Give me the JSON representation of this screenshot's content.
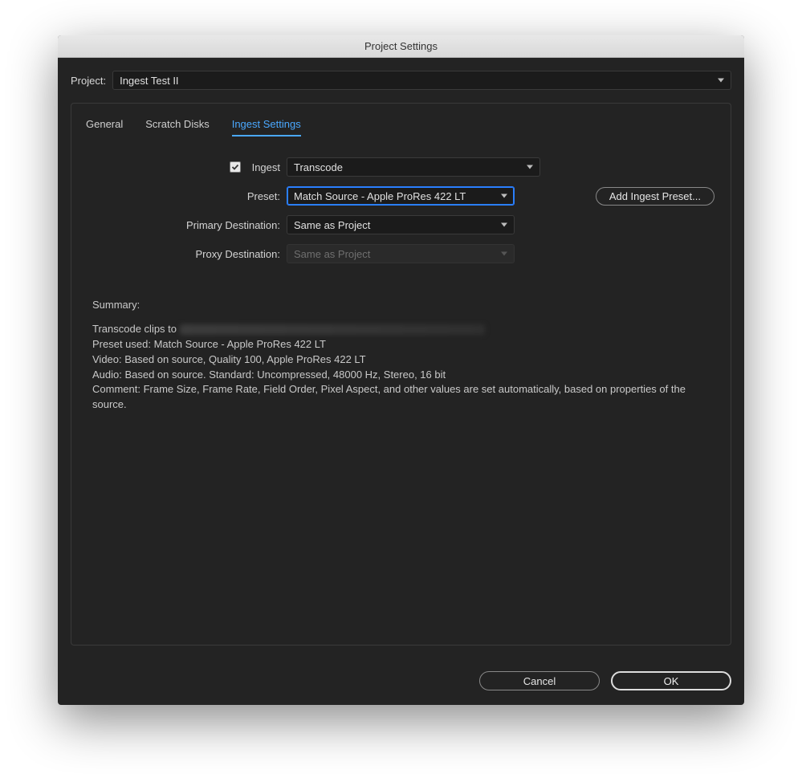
{
  "window": {
    "title": "Project Settings"
  },
  "project": {
    "label": "Project:",
    "selected": "Ingest Test II"
  },
  "tabs": {
    "general": "General",
    "scratch_disks": "Scratch Disks",
    "ingest_settings": "Ingest Settings"
  },
  "form": {
    "ingest_label": "Ingest",
    "ingest_checked": true,
    "ingest_mode": "Transcode",
    "preset_label": "Preset:",
    "preset_value": "Match Source - Apple ProRes 422 LT",
    "add_ingest_preset": "Add Ingest Preset...",
    "primary_dest_label": "Primary Destination:",
    "primary_dest_value": "Same as Project",
    "proxy_dest_label": "Proxy Destination:",
    "proxy_dest_value": "Same as Project"
  },
  "summary": {
    "label": "Summary:",
    "line1_prefix": "Transcode clips to ",
    "line2": "Preset used: Match Source - Apple ProRes 422 LT",
    "line3": "Video: Based on source, Quality 100, Apple ProRes 422 LT",
    "line4": "Audio: Based on source. Standard: Uncompressed, 48000 Hz, Stereo, 16 bit",
    "line5": "Comment: Frame Size, Frame Rate, Field Order, Pixel Aspect, and other values are set automatically, based on properties of the source."
  },
  "footer": {
    "cancel": "Cancel",
    "ok": "OK"
  }
}
